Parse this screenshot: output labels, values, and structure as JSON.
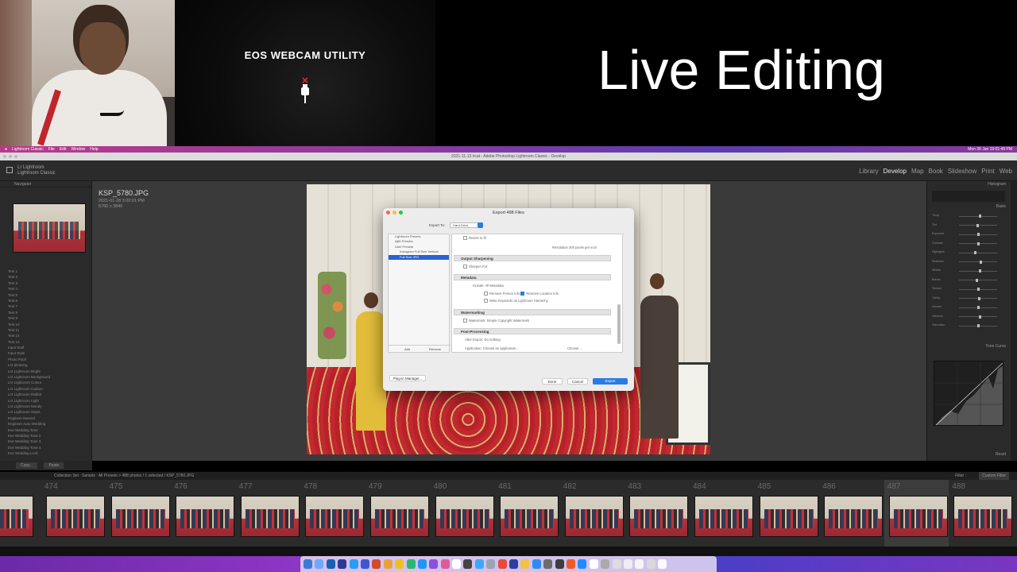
{
  "banner": {
    "eos_title": "EOS WEBCAM UTILITY",
    "live_title": "Live Editing"
  },
  "menubar": {
    "items": [
      "Lightroom Classic",
      "File",
      "Edit",
      "Window",
      "Help"
    ],
    "clock": "Mon 30 Jun 19:01:49 PM"
  },
  "window": {
    "title": "2021-11-13 lrcat - Adobe Photoshop Lightroom Classic - Develop",
    "brand_line1": "Lr Lightroom",
    "brand_line2": "Lightroom Classic"
  },
  "modules": [
    "Library",
    "Develop",
    "Map",
    "Book",
    "Slideshow",
    "Print",
    "Web"
  ],
  "active_module": "Develop",
  "left_panel": {
    "header": "Navigator",
    "tree": [
      "Test 1",
      "Test 2",
      "Test 3",
      "Test 4",
      "Test 5",
      "Test 6",
      "Test 7",
      "Test 8",
      "Test 9",
      "Test 10",
      "Test 11",
      "Test 12",
      "Test 13",
      "Input Stuff",
      "Input Style",
      "Photo Pack",
      "Lr4 pleasing",
      "Lr4 Lightroom Bright",
      "Lr4 Lightroom Background",
      "Lr4 Lightroom Colour",
      "Lr4 Lightroom Carbon",
      "Lr4 Lightroom Rabbit",
      "Lr4 Lightroom Light",
      "Lr4 Lightroom Moody",
      "Lr4 Lightroom Sepia",
      "Engineer Neutral",
      "Engineer Auto Wedding",
      "Eve Wedding Tone",
      "Eve Wedding Tone 2",
      "Eve Wedding Tone 3",
      "Eve Wedding Tone 4",
      "Eve Wedding Look"
    ],
    "tools": [
      "Copy...",
      "Paste"
    ]
  },
  "photo": {
    "filename": "KSP_5780.JPG",
    "date": "2021-01-28 3:00:01 PM",
    "dims": "5760 x 3840"
  },
  "dialog": {
    "title": "Export 488 Files",
    "export_to_label": "Export To:",
    "export_to_value": "Hard Drive",
    "presets": [
      "Lightroom Presets",
      "Ajith Presets",
      "User Presets",
      "Instagram Full Size Vertical",
      "Full Size JPG"
    ],
    "selected_preset": "Full Size JPG",
    "preset_add": "Add",
    "preset_remove": "Remove",
    "sections": {
      "output_sharpening": "Output Sharpening",
      "metadata": "Metadata",
      "watermarking": "Watermarking",
      "post_processing": "Post-Processing"
    },
    "resize_label": "Resize to fit",
    "resolution_label": "Resolution",
    "resolution_value": "300",
    "resolution_unit": "pixels per inch",
    "sharpen_for": "Sharpen For:",
    "include_label": "Include:",
    "include_value": "All Metadata",
    "remove_person": "Remove Person Info",
    "remove_location": "Remove Location Info",
    "write_keywords": "Write Keywords as Lightroom Hierarchy",
    "watermark_label": "Watermark:",
    "watermark_value": "Simple Copyright Watermark",
    "after_export_label": "After Export:",
    "after_export_value": "Do nothing",
    "application_label": "Application:",
    "application_value": "Choose an application...",
    "choose_label": "Choose...",
    "plugin_manager": "Plug-in Manager...",
    "done": "Done",
    "cancel": "Cancel",
    "export": "Export"
  },
  "right_panel": {
    "header": "Histogram",
    "basic": "Basic",
    "tone_curve": "Tone Curve",
    "sliders": [
      {
        "label": "Temp",
        "value": 0.55
      },
      {
        "label": "Tint",
        "value": 0.48
      },
      {
        "label": "Exposure",
        "value": 0.52
      },
      {
        "label": "Contrast",
        "value": 0.5
      },
      {
        "label": "Highlights",
        "value": 0.42
      },
      {
        "label": "Shadows",
        "value": 0.58
      },
      {
        "label": "Whites",
        "value": 0.55
      },
      {
        "label": "Blacks",
        "value": 0.46
      },
      {
        "label": "Texture",
        "value": 0.5
      },
      {
        "label": "Clarity",
        "value": 0.53
      },
      {
        "label": "Dehaze",
        "value": 0.5
      },
      {
        "label": "Vibrance",
        "value": 0.56
      },
      {
        "label": "Saturation",
        "value": 0.5
      }
    ],
    "reset": "Reset"
  },
  "filmstrip": {
    "breadcrumb": "Collection Set : Sample : All Presets  >  488 photos / 1 selected / KSP_5780.JPG",
    "filter": "Filter :",
    "filter_value": "Custom Filter",
    "frames": [
      "474",
      "475",
      "476",
      "477",
      "478",
      "479",
      "480",
      "481",
      "482",
      "483",
      "484",
      "485",
      "486",
      "487",
      "488"
    ],
    "selected_frame": "487"
  }
}
